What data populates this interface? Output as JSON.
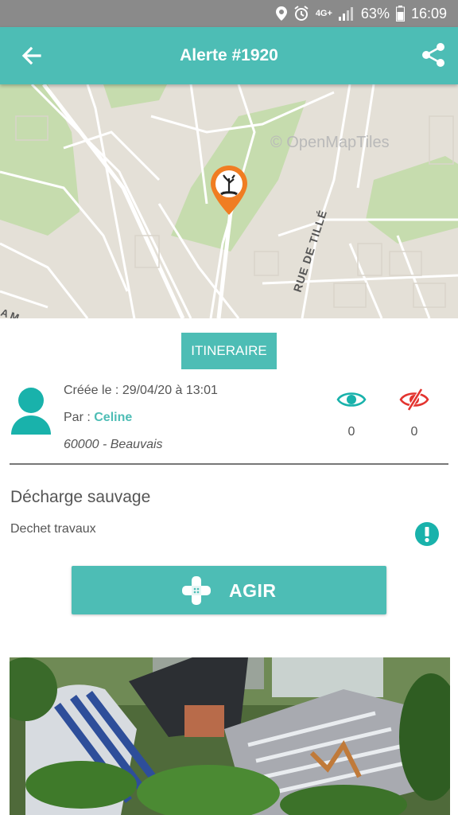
{
  "status_bar": {
    "network": "4G+",
    "battery": "63%",
    "time": "16:09"
  },
  "header": {
    "title": "Alerte #1920"
  },
  "map": {
    "attribution": "© OpenMapTiles",
    "street_label": "RUE DE TILLÉ",
    "edge_label": "A M"
  },
  "actions": {
    "itinerary_label": "ITINERAIRE",
    "act_label": "AGIR"
  },
  "alert": {
    "created": "Créée le : 29/04/20 à 13:01",
    "by_prefix": "Par : ",
    "author": "Celine",
    "location": "60000 - Beauvais",
    "views_count": "0",
    "hidden_count": "0",
    "category": "Décharge sauvage",
    "subcategory": "Dechet travaux"
  },
  "colors": {
    "accent": "#4dbdb5",
    "marker": "#f07d22",
    "hidden_icon": "#e3342f",
    "status_bar": "#8a8a8a"
  },
  "icons": [
    "back-arrow-icon",
    "share-icon",
    "location-icon",
    "alarm-icon",
    "signal-icon",
    "battery-icon",
    "map-pin-icon",
    "user-avatar-icon",
    "eye-icon",
    "eye-off-icon",
    "warning-icon",
    "bandage-icon"
  ]
}
